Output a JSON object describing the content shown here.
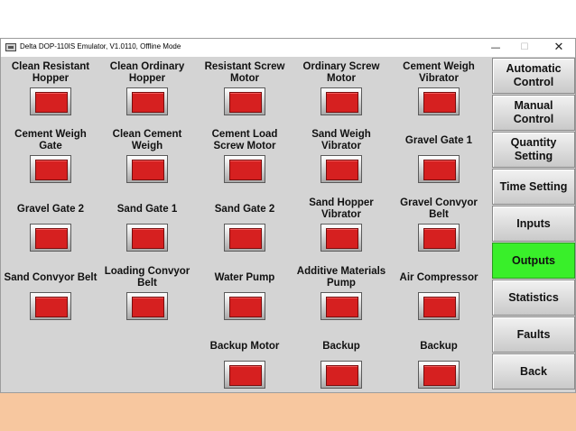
{
  "window": {
    "title": "Delta DOP-110IS Emulator, V1.0110, Offline Mode",
    "minimize_glyph": "—",
    "maximize_glyph": "☐",
    "close_glyph": "✕"
  },
  "outputs": [
    {
      "label": "Clean Resistant Hopper",
      "state": "off"
    },
    {
      "label": "Clean Ordinary Hopper",
      "state": "off"
    },
    {
      "label": "Resistant Screw Motor",
      "state": "off"
    },
    {
      "label": "Ordinary Screw Motor",
      "state": "off"
    },
    {
      "label": "Cement Weigh Vibrator",
      "state": "off"
    },
    {
      "label": "Cement Weigh Gate",
      "state": "off"
    },
    {
      "label": "Clean Cement Weigh",
      "state": "off"
    },
    {
      "label": "Cement Load Screw Motor",
      "state": "off"
    },
    {
      "label": "Sand Weigh Vibrator",
      "state": "off"
    },
    {
      "label": "Gravel Gate 1",
      "state": "off"
    },
    {
      "label": "Gravel Gate 2",
      "state": "off"
    },
    {
      "label": "Sand Gate 1",
      "state": "off"
    },
    {
      "label": "Sand Gate 2",
      "state": "off"
    },
    {
      "label": "Sand Hopper Vibrator",
      "state": "off"
    },
    {
      "label": "Gravel Convyor Belt",
      "state": "off"
    },
    {
      "label": "Sand Convyor Belt",
      "state": "off"
    },
    {
      "label": "Loading Convyor Belt",
      "state": "off"
    },
    {
      "label": "Water Pump",
      "state": "off"
    },
    {
      "label": "Additive Materials Pump",
      "state": "off"
    },
    {
      "label": "Air Compressor",
      "state": "off"
    },
    {
      "label": "Backup Motor",
      "state": "off"
    },
    {
      "label": "Backup",
      "state": "off"
    },
    {
      "label": "Backup",
      "state": "off"
    }
  ],
  "nav": [
    {
      "label": "Automatic Control",
      "active": false
    },
    {
      "label": "Manual Control",
      "active": false
    },
    {
      "label": "Quantity Setting",
      "active": false
    },
    {
      "label": "Time Setting",
      "active": false
    },
    {
      "label": "Inputs",
      "active": false
    },
    {
      "label": "Outputs",
      "active": true
    },
    {
      "label": "Statistics",
      "active": false
    },
    {
      "label": "Faults",
      "active": false
    },
    {
      "label": "Back",
      "active": false
    }
  ],
  "colors": {
    "lamp_off": "#d62020",
    "active_nav": "#39ef2a",
    "panel_bg": "#d4d4d4",
    "desktop_bg": "#f7c79f"
  }
}
